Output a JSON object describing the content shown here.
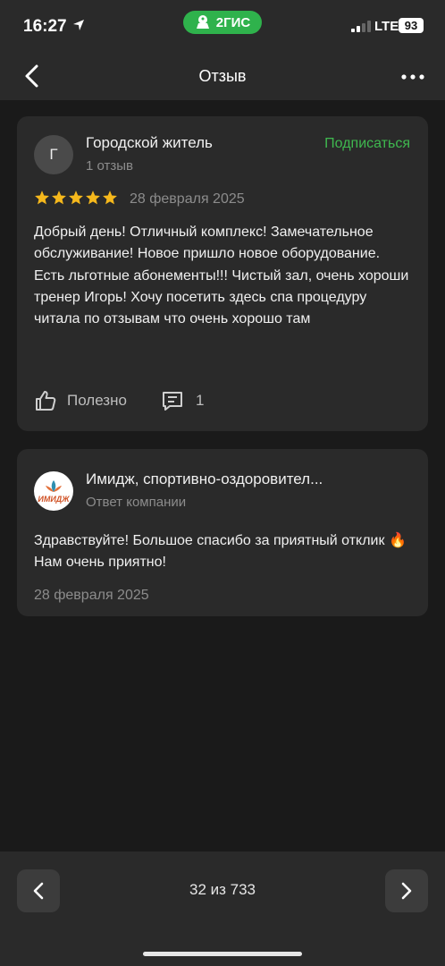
{
  "status_bar": {
    "time": "16:27",
    "app_badge": "2ГИС",
    "network": "LTE",
    "battery": "93"
  },
  "nav": {
    "title": "Отзыв"
  },
  "review": {
    "avatar_letter": "Г",
    "author": "Городской житель",
    "author_reviews": "1 отзыв",
    "subscribe_label": "Подписаться",
    "rating": 5,
    "date": "28 февраля 2025",
    "text": "Добрый день! Отличный комплекс! Замечательное обслуживание! Новое пришло новое оборудование. Есть льготные абонементы!!! Чистый зал, очень хороши тренер Игорь! Хочу посетить здесь спа процедуру читала по отзывам что очень хорошо там",
    "useful_label": "Полезно",
    "comments_count": "1"
  },
  "reply": {
    "logo_text": "ИМИДЖ",
    "company": "Имидж, спортивно-оздоровител...",
    "label": "Ответ компании",
    "text": "Здравствуйте! Большое спасибо за приятный отклик 🔥 Нам очень приятно!",
    "date": "28 февраля 2025"
  },
  "pagination": {
    "label": "32 из 733"
  },
  "colors": {
    "accent_green": "#3fb84f",
    "star": "#f5b81c",
    "background": "#1a1a1a",
    "card": "#2a2a2a"
  }
}
